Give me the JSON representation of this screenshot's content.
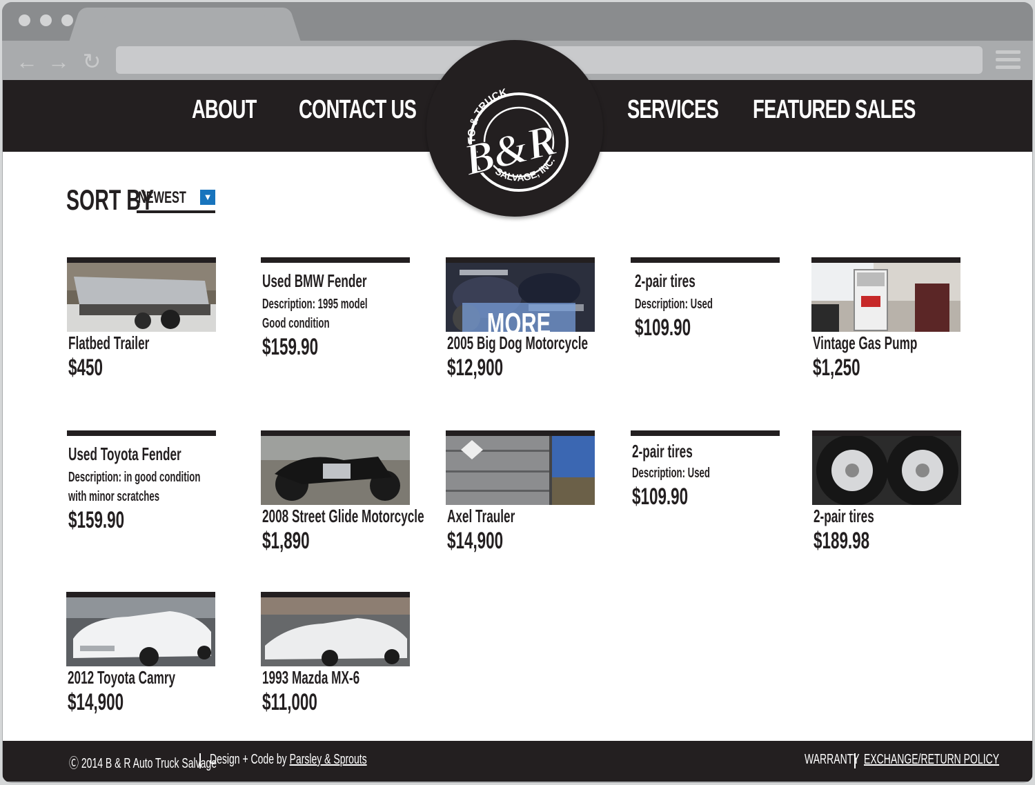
{
  "browser": {
    "back_icon": "←",
    "forward_icon": "→",
    "reload_icon": "↻"
  },
  "nav": {
    "about": "ABOUT",
    "contact": "CONTACT US",
    "services": "SERVICES",
    "featured": "FEATURED SALES",
    "logo_top": "AUTO & TRUCK",
    "logo_main": "B&R",
    "logo_bottom": "SALVAGE, INC."
  },
  "sort": {
    "label": "SORT BY",
    "value": "NEWEST",
    "arrow_icon": "chevron-down-icon"
  },
  "products": [
    {
      "name": "Flatbed Trailer",
      "price": "$450",
      "image": "flatbed-trailer-photo"
    },
    {
      "name": "Used BMW Fender",
      "desc1": "Description: 1995 model",
      "desc2": "Good condition",
      "price": "$159.90"
    },
    {
      "name": "2005 Big Dog Motorcycle",
      "price": "$12,900",
      "image": "motorcycle-photo",
      "overlay": "MORE"
    },
    {
      "name": "2-pair tires",
      "desc1": "Description: Used",
      "price": "$109.90"
    },
    {
      "name": "Vintage Gas Pump",
      "price": "$1,250",
      "image": "gas-pump-photo"
    },
    {
      "name": "Used Toyota Fender",
      "desc1": "Description: in good condition",
      "desc2": "with minor scratches",
      "price": "$159.90"
    },
    {
      "name": "2008 Street Glide Motorcycle",
      "price": "$1,890",
      "image": "street-glide-photo"
    },
    {
      "name": "Axel Trauler",
      "price": "$14,900",
      "image": "axel-trailer-photo"
    },
    {
      "name": "2-pair tires",
      "desc1": "Description: Used",
      "price": "$109.90"
    },
    {
      "name": "2-pair tires",
      "price": "$189.98",
      "image": "tires-photo"
    },
    {
      "name": "2012 Toyota Camry",
      "price": "$14,900",
      "image": "camry-photo"
    },
    {
      "name": "1993 Mazda MX-6",
      "price": "$11,000",
      "image": "mazda-photo"
    }
  ],
  "footer": {
    "copyright": "Ⓒ 2014 B & R Auto Truck Salvage",
    "credit_prefix": "Design + Code by ",
    "credit_link": "Parsley & Sprouts",
    "warranty": "WARRANTY",
    "policy": "EXCHANGE/RETURN POLICY"
  },
  "colors": {
    "header_bg": "#231f20",
    "accent_blue": "#1874bd",
    "chrome_gray": "#8a8c8e"
  }
}
